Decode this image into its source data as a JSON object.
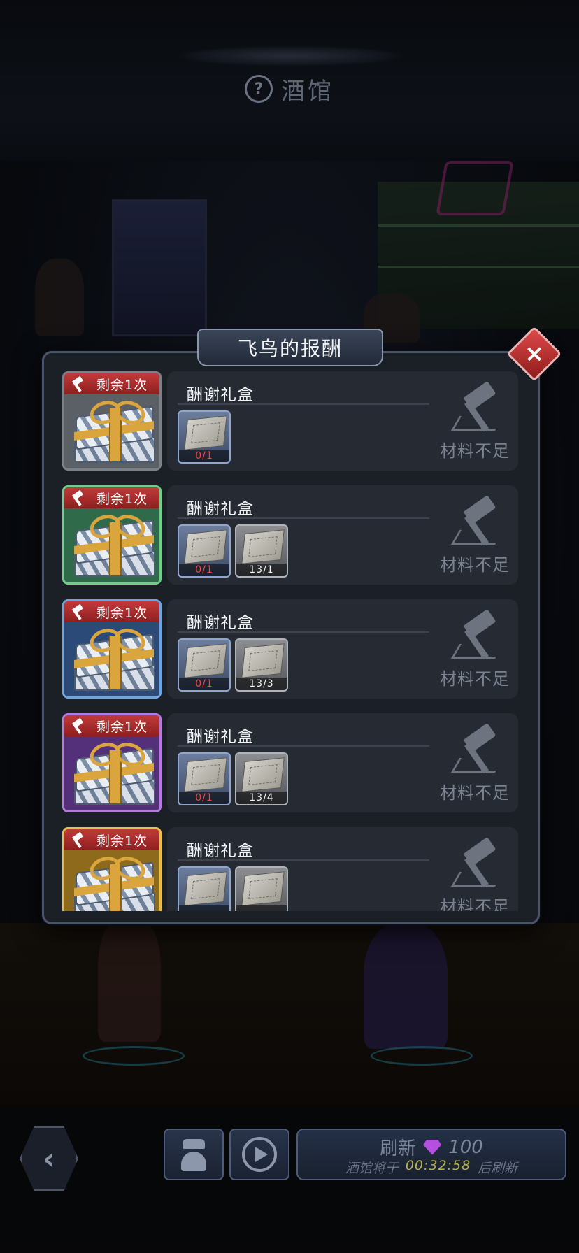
{
  "screen": {
    "title": "酒馆"
  },
  "modal": {
    "title": "飞鸟的报酬",
    "items": [
      {
        "remain": "剩余1次",
        "name": "酬谢礼盒",
        "frame_color": "#7d8087",
        "bg_color": "#5b5f66",
        "materials": [
          {
            "count": "0/1",
            "count_color": "red",
            "style": "blue"
          }
        ],
        "action": "材料不足"
      },
      {
        "remain": "剩余1次",
        "name": "酬谢礼盒",
        "frame_color": "#6fcf8a",
        "bg_color": "#2f6b4a",
        "materials": [
          {
            "count": "0/1",
            "count_color": "red",
            "style": "blue"
          },
          {
            "count": "13/1",
            "count_color": "white",
            "style": "grey"
          }
        ],
        "action": "材料不足"
      },
      {
        "remain": "剩余1次",
        "name": "酬谢礼盒",
        "frame_color": "#6fa4e0",
        "bg_color": "#2c4a78",
        "materials": [
          {
            "count": "0/1",
            "count_color": "red",
            "style": "blue"
          },
          {
            "count": "13/3",
            "count_color": "white",
            "style": "grey"
          }
        ],
        "action": "材料不足"
      },
      {
        "remain": "剩余1次",
        "name": "酬谢礼盒",
        "frame_color": "#b47ae0",
        "bg_color": "#54307a",
        "materials": [
          {
            "count": "0/1",
            "count_color": "red",
            "style": "blue"
          },
          {
            "count": "13/4",
            "count_color": "white",
            "style": "grey"
          }
        ],
        "action": "材料不足"
      },
      {
        "remain": "剩余1次",
        "name": "酬谢礼盒",
        "frame_color": "#e6c04a",
        "bg_color": "#8d6a1c",
        "materials": [
          {
            "count": "",
            "count_color": "red",
            "style": "blue"
          },
          {
            "count": "",
            "count_color": "white",
            "style": "grey"
          }
        ],
        "action": "材料不足"
      }
    ]
  },
  "bottom": {
    "refresh_label": "刷新",
    "refresh_cost": "100",
    "gem_color": "#b44fe0",
    "timer_prefix": "酒馆将于",
    "timer_time": "00:32:58",
    "timer_suffix": "后刷新"
  },
  "icons": [
    "help-icon",
    "close-icon",
    "back-arrow-icon",
    "spy-icon",
    "play-icon",
    "gem-icon",
    "hammer-icon",
    "gift-box-icon",
    "blueprint-icon"
  ]
}
